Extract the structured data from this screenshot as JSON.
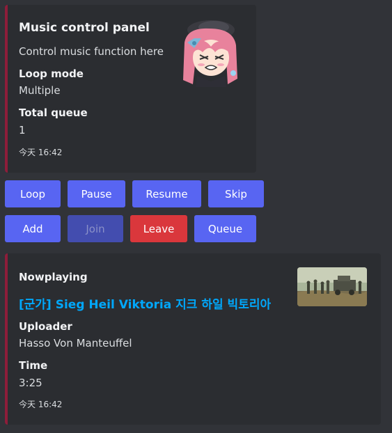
{
  "colors": {
    "background": "#313338",
    "embed_background": "#2b2d31",
    "embed_border": "#8e1d3a",
    "primary_button": "#5865f2",
    "danger_button": "#da373c",
    "link": "#00a8fc"
  },
  "control_panel": {
    "title": "Music control panel",
    "description": "Control music function here",
    "fields": [
      {
        "name": "Loop mode",
        "value": "Multiple"
      },
      {
        "name": "Total queue",
        "value": "1"
      }
    ],
    "footer": "今天 16:42",
    "thumbnail": "anime-character-avatar"
  },
  "buttons": {
    "row1": [
      {
        "label": "Loop",
        "style": "primary",
        "disabled": false
      },
      {
        "label": "Pause",
        "style": "primary",
        "disabled": false
      },
      {
        "label": "Resume",
        "style": "primary",
        "disabled": false
      },
      {
        "label": "Skip",
        "style": "primary",
        "disabled": false
      }
    ],
    "row2": [
      {
        "label": "Add",
        "style": "primary",
        "disabled": false
      },
      {
        "label": "Join",
        "style": "primary",
        "disabled": true
      },
      {
        "label": "Leave",
        "style": "danger",
        "disabled": false
      },
      {
        "label": "Queue",
        "style": "primary",
        "disabled": false
      }
    ]
  },
  "now_playing": {
    "author": "Nowplaying",
    "title": "[군가] Sieg Heil Viktoria 지크 하일 빅토리아",
    "fields": [
      {
        "name": "Uploader",
        "value": "Hasso Von Manteuffel"
      },
      {
        "name": "Time",
        "value": "3:25"
      }
    ],
    "footer": "今天 16:42",
    "thumbnail": "video-thumbnail-soldiers"
  }
}
